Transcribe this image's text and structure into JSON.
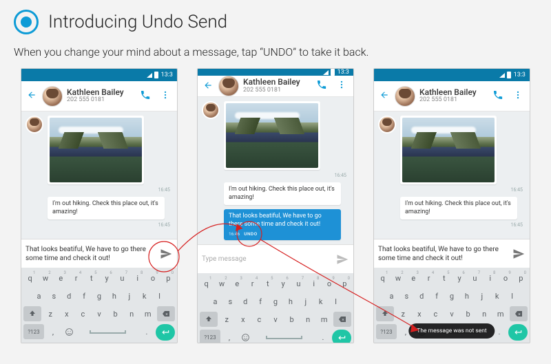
{
  "header": {
    "title": "Introducing Undo Send",
    "subtitle": "When you change your mind about a message,  tap “UNDO” to take it back."
  },
  "statusbar": {
    "time": "13:3"
  },
  "contact": {
    "name": "Kathleen Bailey",
    "number": "202 555 0181"
  },
  "msg": {
    "received": "I'm out hiking. Check this place out, it's amazing!",
    "photo_time": "16:45",
    "received_time": "16:45",
    "sent": "That looks beatiful, We have to go there some time and check it out!",
    "sent_time": "16:46",
    "undo_label": "UNDO"
  },
  "compose": {
    "draft": "That looks beatiful, We have to go there some time and check it out!",
    "placeholder": "Type message"
  },
  "toast": {
    "not_sent": "The message was not sent"
  },
  "icons": {
    "back": "back-arrow",
    "phone": "phone-icon",
    "more": "more-vert-icon",
    "send": "send-icon",
    "shift": "shift-icon",
    "backspace": "backspace-icon",
    "emoji": "emoji-icon",
    "enter": "enter-icon"
  },
  "keyboard": {
    "row1": [
      {
        "k": "q",
        "s": "1"
      },
      {
        "k": "w",
        "s": "2"
      },
      {
        "k": "e",
        "s": "3"
      },
      {
        "k": "r",
        "s": "4"
      },
      {
        "k": "t",
        "s": "5"
      },
      {
        "k": "y",
        "s": "6"
      },
      {
        "k": "u",
        "s": "7"
      },
      {
        "k": "i",
        "s": "8"
      },
      {
        "k": "o",
        "s": "9"
      },
      {
        "k": "p",
        "s": "0"
      }
    ],
    "row2": [
      "a",
      "s",
      "d",
      "f",
      "g",
      "h",
      "j",
      "k",
      "l"
    ],
    "row3": [
      "z",
      "x",
      "c",
      "v",
      "b",
      "n",
      "m"
    ],
    "symkey": "?123",
    "comma": ",",
    "period": "."
  }
}
